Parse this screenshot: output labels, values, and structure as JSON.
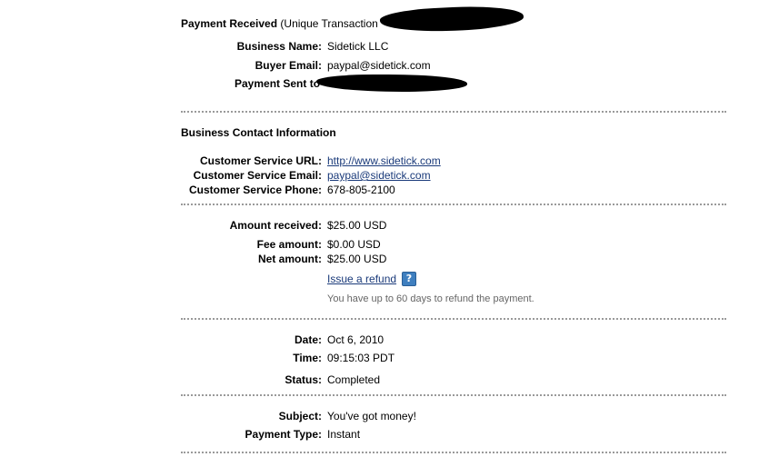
{
  "header": {
    "title_bold": "Payment Received",
    "title_rest": "(Unique Transaction"
  },
  "payment_info": {
    "business_name_label": "Business Name:",
    "business_name_value": "Sidetick LLC",
    "buyer_email_label": "Buyer Email:",
    "buyer_email_value": "paypal@sidetick.com",
    "payment_sent_label": "Payment Sent to"
  },
  "contact": {
    "heading": "Business Contact Information",
    "url_label": "Customer Service URL:",
    "url_value": "http://www.sidetick.com",
    "email_label": "Customer Service Email:",
    "email_value": "paypal@sidetick.com",
    "phone_label": "Customer Service Phone:",
    "phone_value": "678-805-2100"
  },
  "amounts": {
    "received_label": "Amount received:",
    "received_value": "$25.00 USD",
    "fee_label": "Fee amount:",
    "fee_value": "$0.00 USD",
    "net_label": "Net amount:",
    "net_value": "$25.00 USD",
    "refund_link": "Issue a refund",
    "help_glyph": "?",
    "refund_note": "You have up to 60 days to refund the payment."
  },
  "details": {
    "date_label": "Date:",
    "date_value": "Oct 6, 2010",
    "time_label": "Time:",
    "time_value": "09:15:03 PDT",
    "status_label": "Status:",
    "status_value": "Completed"
  },
  "message": {
    "subject_label": "Subject:",
    "subject_value": "You've got money!",
    "type_label": "Payment Type:",
    "type_value": "Instant"
  },
  "icons": {
    "help": "help-icon",
    "redaction": "redaction-mark"
  },
  "colors": {
    "link": "#1a3a7a",
    "separator": "#9a9a9a",
    "note": "#666666",
    "help_icon": "#3f7fbf"
  }
}
